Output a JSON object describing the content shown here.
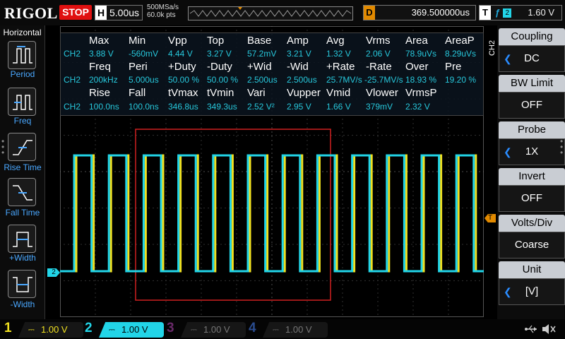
{
  "topbar": {
    "logo": "RIGOL",
    "run_state": "STOP",
    "timebase_label": "H",
    "timebase": "5.00us",
    "sample_rate": "500MSa/s",
    "mem_depth": "60.0k pts",
    "trig_pos_label": "D",
    "trig_pos": "369.500000us",
    "trig_label": "T",
    "trig_src": "2",
    "trig_level": "1.60 V"
  },
  "left_panel": {
    "title": "Horizontal",
    "items": [
      {
        "label": "Period"
      },
      {
        "label": "Freq"
      },
      {
        "label": "Rise Time"
      },
      {
        "label": "Fall Time"
      },
      {
        "label": "+Width"
      },
      {
        "label": "-Width"
      }
    ]
  },
  "right_panel": {
    "side_label": "CH2",
    "menus": [
      {
        "title": "Coupling",
        "value": "DC"
      },
      {
        "title": "BW Limit",
        "value": "OFF"
      },
      {
        "title": "Probe",
        "value": "1X"
      },
      {
        "title": "Invert",
        "value": "OFF"
      },
      {
        "title": "Volts/Div",
        "value": "Coarse"
      },
      {
        "title": "Unit",
        "value": "[V]"
      }
    ]
  },
  "measurements": {
    "row1_hdr": [
      "Max",
      "Min",
      "Vpp",
      "Top",
      "Base",
      "Amp",
      "Avg",
      "Vrms",
      "Area",
      "AreaP"
    ],
    "row1_val": [
      "CH2",
      "3.88 V",
      "-560mV",
      "4.44 V",
      "3.27 V",
      "57.2mV",
      "3.21 V",
      "1.32 V",
      "2.06 V",
      "78.9uVs",
      "8.29uVs"
    ],
    "row2_hdr": [
      "Freq",
      "Peri",
      "+Duty",
      "-Duty",
      "+Wid",
      "-Wid",
      "+Rate",
      "-Rate",
      "Over",
      "Pre"
    ],
    "row2_val": [
      "CH2",
      "200kHz",
      "5.000us",
      "50.00 %",
      "50.00 %",
      "2.500us",
      "2.500us",
      "25.7MV/s",
      "-25.7MV/s",
      "18.93 %",
      "19.20 %"
    ],
    "row3_hdr": [
      "Rise",
      "Fall",
      "tVmax",
      "tVmin",
      "Vari",
      "Vupper",
      "Vmid",
      "Vlower",
      "VrmsP"
    ],
    "row3_val": [
      "CH2",
      "100.0ns",
      "100.0ns",
      "346.8us",
      "349.3us",
      "2.52 V²",
      "2.95 V",
      "1.66 V",
      "379mV",
      "2.32 V"
    ]
  },
  "markers": {
    "ch2": "2",
    "trigger": "T"
  },
  "channels": [
    {
      "num": "1",
      "scale": "1.00 V",
      "color": "#f0e020",
      "active": false
    },
    {
      "num": "2",
      "scale": "1.00 V",
      "color": "#22d5e8",
      "active": true
    },
    {
      "num": "3",
      "scale": "1.00 V",
      "color": "#c040c0",
      "active": false
    },
    {
      "num": "4",
      "scale": "1.00 V",
      "color": "#2a6cff",
      "active": false
    }
  ],
  "colors": {
    "ch1": "#f0e020",
    "ch2": "#22d5e8",
    "stop": "#e01010",
    "trigger": "#e28a00",
    "zoom_box": "#d02020"
  },
  "icons": [
    "usb-icon",
    "speaker-mute-icon"
  ]
}
